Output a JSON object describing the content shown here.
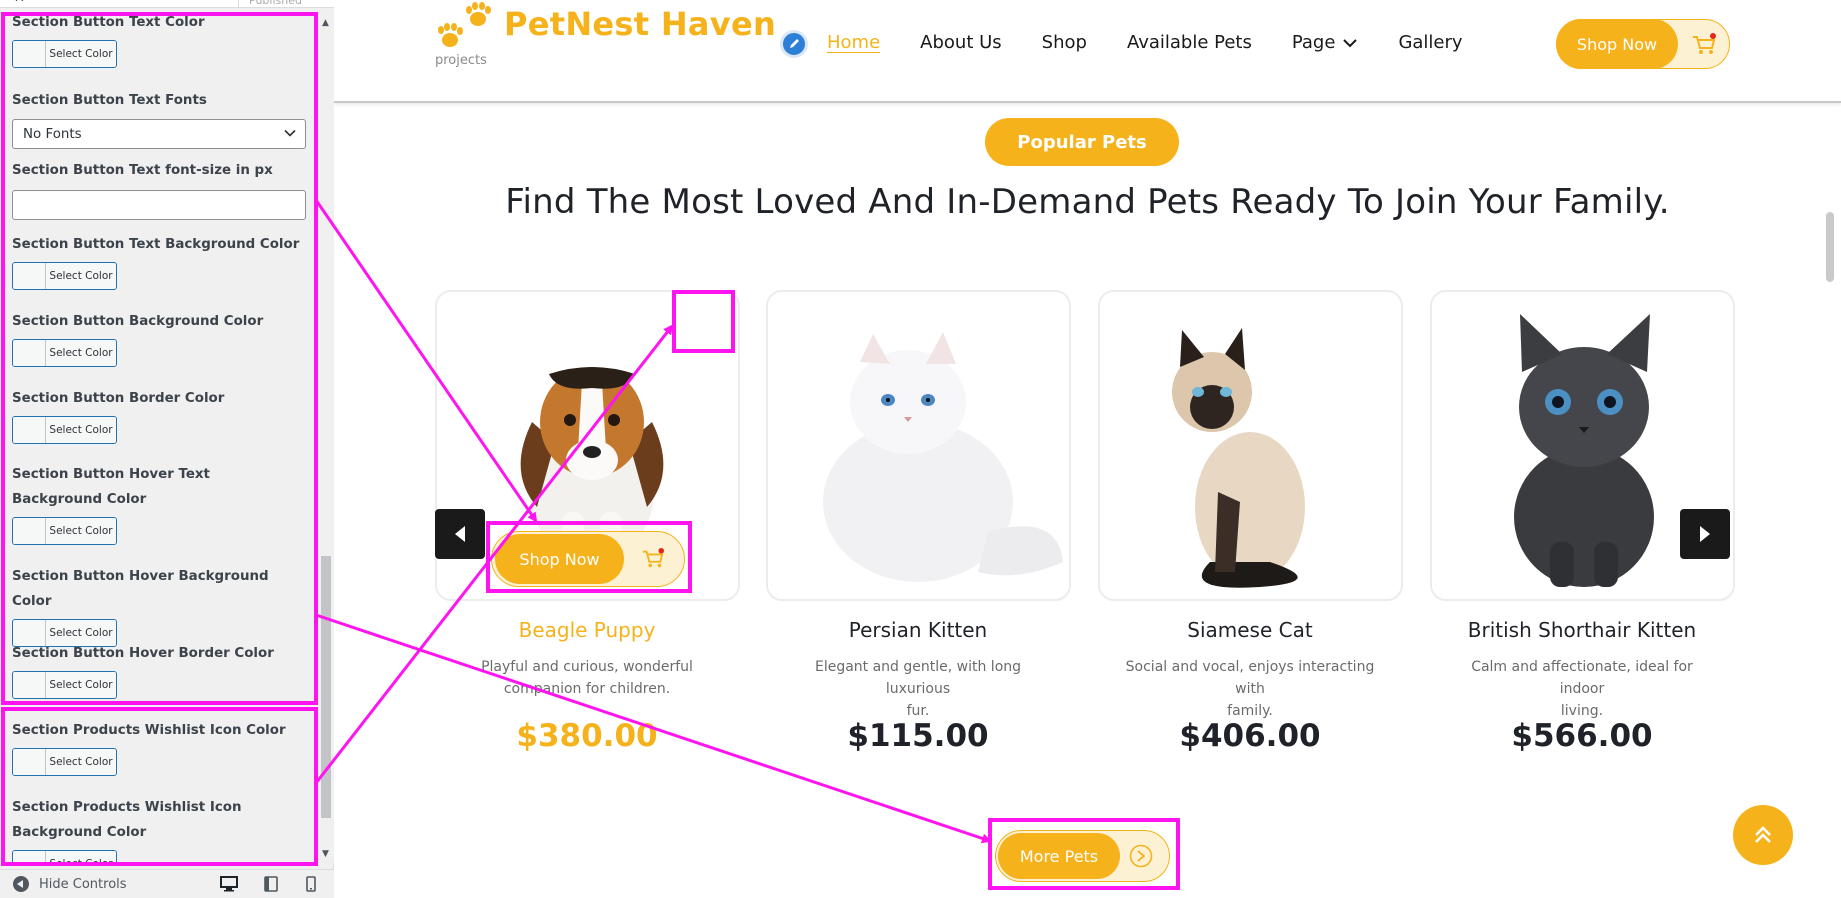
{
  "sidebar": {
    "published_label": "Published",
    "controls": [
      {
        "label": "Section Button Text Color",
        "kind": "color"
      },
      {
        "label": "Section Button Text Fonts",
        "kind": "select"
      },
      {
        "label": "Section Button Text font-size in px",
        "kind": "input"
      },
      {
        "label": "Section Button Text Background Color",
        "kind": "color"
      },
      {
        "label": "Section Button Background Color",
        "kind": "color"
      },
      {
        "label": "Section Button Border Color",
        "kind": "color"
      },
      {
        "label": "Section Button Hover Text Background Color",
        "kind": "color"
      },
      {
        "label": "Section Button Hover Background Color",
        "kind": "color"
      },
      {
        "label": "Section Button Hover Border Color",
        "kind": "color"
      },
      {
        "label": "Section Products Wishlist Icon Color",
        "kind": "color"
      },
      {
        "label": "Section Products Wishlist Icon Background Color",
        "kind": "color"
      }
    ],
    "select_color_label": "Select Color",
    "font_select_value": "No Fonts",
    "font_size_value": "",
    "footer": {
      "hide_controls_label": "Hide Controls",
      "devices": [
        "desktop-icon",
        "tablet-icon",
        "mobile-icon"
      ]
    }
  },
  "site": {
    "brand": "PetNest Haven",
    "brand_sub": "projects",
    "nav": [
      "Home",
      "About Us",
      "Shop",
      "Available Pets",
      "Page",
      "Gallery"
    ],
    "active_nav": "Home",
    "header_shop_label": "Shop Now",
    "badge": "Popular Pets",
    "heading": "Find The Most Loved And In-Demand Pets Ready To Join Your Family.",
    "card_shop_label": "Shop Now",
    "more_label": "More Pets",
    "products": [
      {
        "name": "Beagle Puppy",
        "desc_line1": "Playful and curious, wonderful",
        "desc_line2": "companion for children.",
        "price": "$380.00",
        "highlight": true
      },
      {
        "name": "Persian Kitten",
        "desc_line1": "Elegant and gentle, with long luxurious",
        "desc_line2": "fur.",
        "price": "$115.00",
        "highlight": false
      },
      {
        "name": "Siamese Cat",
        "desc_line1": "Social and vocal, enjoys interacting with",
        "desc_line2": "family.",
        "price": "$406.00",
        "highlight": false
      },
      {
        "name": "British Shorthair Kitten",
        "desc_line1": "Calm and affectionate, ideal for indoor",
        "desc_line2": "living.",
        "price": "$566.00",
        "highlight": false
      }
    ]
  },
  "colors": {
    "accent": "#f6b21a",
    "annotation": "#ff14f0",
    "wordpress_blue": "#2271b1",
    "dark": "#1a1a1a"
  }
}
